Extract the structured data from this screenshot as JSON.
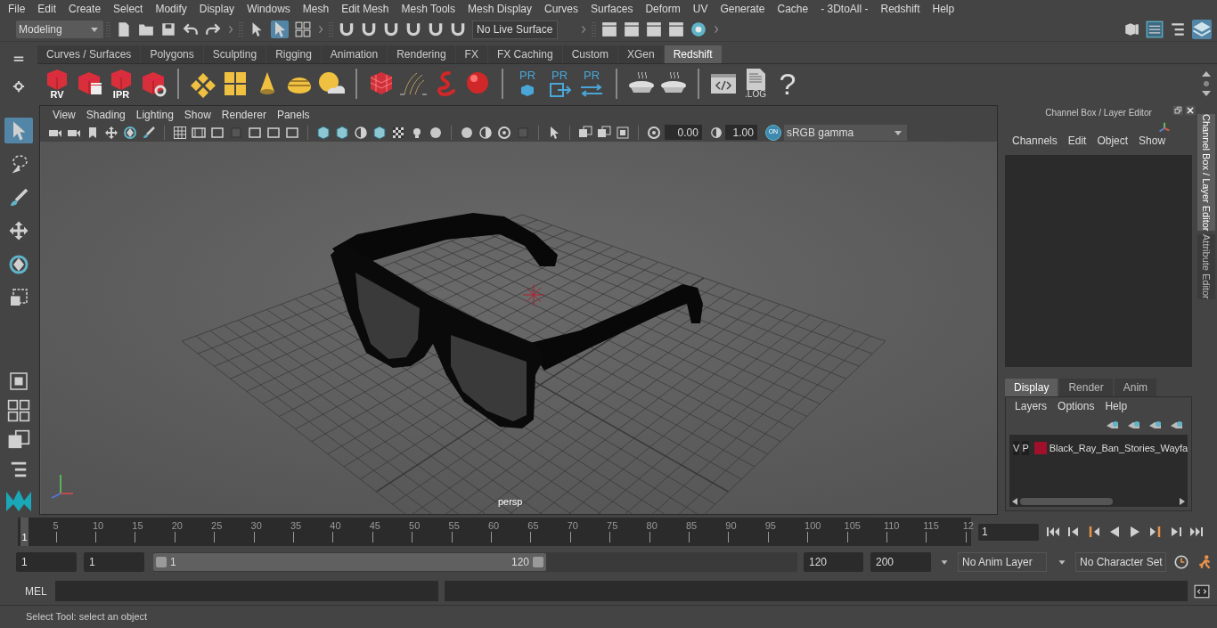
{
  "menu_bar": [
    "File",
    "Edit",
    "Create",
    "Select",
    "Modify",
    "Display",
    "Windows",
    "Mesh",
    "Edit Mesh",
    "Mesh Tools",
    "Mesh Display",
    "Curves",
    "Surfaces",
    "Deform",
    "UV",
    "Generate",
    "Cache",
    "- 3DtoAll -",
    "Redshift",
    "Help"
  ],
  "status_line": {
    "mode": "Modeling",
    "live_surface": "No Live Surface"
  },
  "shelf": {
    "tabs": [
      {
        "label": "Curves / Surfaces",
        "selected": false
      },
      {
        "label": "Polygons",
        "selected": false
      },
      {
        "label": "Sculpting",
        "selected": false
      },
      {
        "label": "Rigging",
        "selected": false
      },
      {
        "label": "Animation",
        "selected": false
      },
      {
        "label": "Rendering",
        "selected": false
      },
      {
        "label": "FX",
        "selected": false
      },
      {
        "label": "FX Caching",
        "selected": false
      },
      {
        "label": "Custom",
        "selected": false
      },
      {
        "label": "XGen",
        "selected": false
      },
      {
        "label": "Redshift",
        "selected": true
      }
    ],
    "items": [
      {
        "kind": "rs-cube",
        "label": "RV"
      },
      {
        "kind": "rs-cube-clapper"
      },
      {
        "kind": "rs-cube",
        "label": "IPR"
      },
      {
        "kind": "rs-cube-gear"
      },
      {
        "kind": "separator"
      },
      {
        "kind": "diamonds"
      },
      {
        "kind": "panels"
      },
      {
        "kind": "cone"
      },
      {
        "kind": "dome"
      },
      {
        "kind": "sun"
      },
      {
        "kind": "separator"
      },
      {
        "kind": "red-grid"
      },
      {
        "kind": "strands"
      },
      {
        "kind": "squiggle"
      },
      {
        "kind": "red-sphere"
      },
      {
        "kind": "separator"
      },
      {
        "kind": "pr-cube",
        "label": "PR"
      },
      {
        "kind": "pr-export",
        "label": "PR"
      },
      {
        "kind": "pr-arrows",
        "label": "PR"
      },
      {
        "kind": "separator"
      },
      {
        "kind": "pie"
      },
      {
        "kind": "pie"
      },
      {
        "kind": "separator"
      },
      {
        "kind": "code"
      },
      {
        "kind": "log",
        "label": ".LOG"
      },
      {
        "kind": "text",
        "label": "?"
      }
    ]
  },
  "tools": [
    {
      "kind": "select",
      "selected": true
    },
    {
      "kind": "lasso",
      "selected": false
    },
    {
      "kind": "paint",
      "selected": false
    },
    {
      "kind": "move",
      "selected": false
    },
    {
      "kind": "rotate",
      "selected": false
    },
    {
      "kind": "scale",
      "selected": false
    }
  ],
  "viewport": {
    "menu": [
      "View",
      "Shading",
      "Lighting",
      "Show",
      "Renderer",
      "Panels"
    ],
    "exposure": "0.00",
    "gamma": "1.00",
    "color_management": "ON",
    "color_space": "sRGB gamma",
    "camera": "persp"
  },
  "channel_box": {
    "title": "Channel Box / Layer Editor",
    "menu": [
      "Channels",
      "Edit",
      "Object",
      "Show"
    ]
  },
  "layer_editor": {
    "tabs": [
      {
        "label": "Display",
        "selected": true
      },
      {
        "label": "Render",
        "selected": false
      },
      {
        "label": "Anim",
        "selected": false
      }
    ],
    "menu": [
      "Layers",
      "Options",
      "Help"
    ],
    "layers": [
      {
        "visibility": "V",
        "playback": "P",
        "color": "#a0102a",
        "name": "Black_Ray_Ban_Stories_Wayfa"
      }
    ]
  },
  "side_tabs": [
    {
      "label": "Channel Box / Layer Editor",
      "selected": true
    },
    {
      "label": "Attribute Editor",
      "selected": false
    }
  ],
  "timeline": {
    "start_label": "1",
    "ticks": [
      "5",
      "10",
      "15",
      "20",
      "25",
      "30",
      "35",
      "40",
      "45",
      "50",
      "55",
      "60",
      "65",
      "70",
      "75",
      "80",
      "85",
      "90",
      "95",
      "100",
      "105",
      "110",
      "115",
      "12"
    ],
    "current_frame": "1"
  },
  "range": {
    "level": 0.61,
    "start": "1",
    "playback_start": "1",
    "slider_start": "1",
    "slider_end": "120",
    "playback_end": "120",
    "end": "200",
    "anim_layer": "No Anim Layer",
    "character_set": "No Character Set"
  },
  "command_line": {
    "language": "MEL"
  },
  "help_line": "Select Tool: select an object"
}
